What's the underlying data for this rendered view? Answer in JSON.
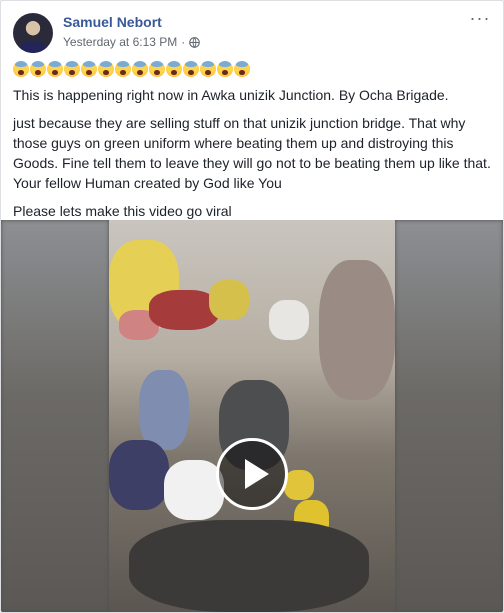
{
  "post": {
    "author_name": "Samuel Nebort",
    "timestamp": "Yesterday at 6:13 PM",
    "separator": "·",
    "privacy_icon": "globe-icon",
    "more_options_icon": "more-options-icon",
    "more_options_label": "···",
    "emoji_name": "loudly-crying-face",
    "emoji_count": 14,
    "paragraphs": [
      "This is happening right now in Awka unizik Junction. By Ocha Brigade.",
      "just because they are selling stuff on that unizik junction bridge. That why those guys on green uniform where beating them up and distroying this Goods. Fine tell them to leave they will go not to be beating them up like that. Your fellow Human created by God like You",
      "Please lets make this video go viral"
    ],
    "media": {
      "type": "video",
      "play_icon": "play-icon"
    }
  },
  "colors": {
    "author_name": "#385898",
    "text": "#1d2129",
    "meta": "#616770",
    "card_background": "#ffffff",
    "page_background": "#e9ebee"
  }
}
